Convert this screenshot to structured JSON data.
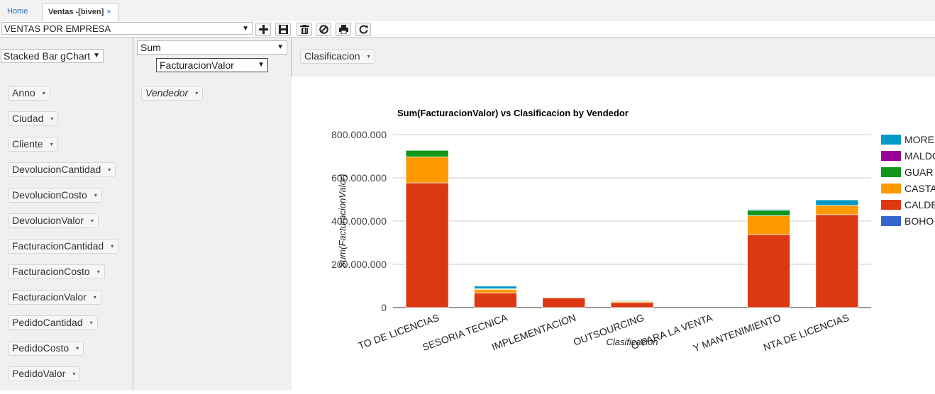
{
  "tabs": [
    {
      "label": "Home"
    },
    {
      "label": "Ventas -[biven]",
      "close": "×"
    }
  ],
  "toolbar": {
    "report_name": "VENTAS POR EMPRESA",
    "buttons": [
      "plus-icon",
      "save-icon",
      "trash-icon",
      "ban-icon",
      "print-icon",
      "refresh-icon"
    ]
  },
  "pivot": {
    "renderer": "Stacked Bar gChart",
    "aggregator": "Sum",
    "value_field": "FacturacionValor",
    "col_fields": [
      "Clasificacion"
    ],
    "row_fields": [
      "Vendedor"
    ],
    "unused_fields": [
      "Anno",
      "Ciudad",
      "Cliente",
      "DevolucionCantidad",
      "DevolucionCosto",
      "DevolucionValor",
      "FacturacionCantidad",
      "FacturacionCosto",
      "FacturacionValor",
      "PedidoCantidad",
      "PedidoCosto",
      "PedidoValor"
    ],
    "dropdown_glyph": "▾"
  },
  "chart_data": {
    "type": "bar",
    "stacked": true,
    "title": "Sum(FacturacionValor) vs Clasificacion by Vendedor",
    "xlabel": "Clasificacion",
    "ylabel": "Sum(FacturacionValor)",
    "ylim": [
      0,
      800000000
    ],
    "yticks": [
      "0",
      "200.000.000",
      "400.000.000",
      "600.000.000",
      "800.000.000"
    ],
    "ytick_values": [
      0,
      200000000,
      400000000,
      600000000,
      800000000
    ],
    "categories": [
      "TO DE LICENCIAS",
      "SESORIA TECNICA",
      "IMPLEMENTACION",
      "OUTSOURCING",
      "O PARA LA VENTA",
      "Y MANTENIMIENTO",
      "NTA DE LICENCIAS"
    ],
    "legend_position": "right",
    "series": [
      {
        "name": "BOHO",
        "color": "#3366cc",
        "values": [
          0,
          0,
          0,
          0,
          0,
          0,
          0
        ]
      },
      {
        "name": "CALDE",
        "color": "#dc3912",
        "values": [
          577000000,
          67000000,
          45000000,
          23000000,
          0,
          338000000,
          430000000
        ]
      },
      {
        "name": "CASTA",
        "color": "#ff9900",
        "values": [
          120000000,
          17000000,
          2000000,
          5000000,
          0,
          87000000,
          43000000
        ]
      },
      {
        "name": "GUAR",
        "color": "#109618",
        "values": [
          30000000,
          3000000,
          0,
          4000000,
          0,
          24000000,
          0
        ]
      },
      {
        "name": "MALDO",
        "color": "#990099",
        "values": [
          0,
          0,
          0,
          0,
          0,
          0,
          0
        ]
      },
      {
        "name": "MORE",
        "color": "#0099c6",
        "values": [
          0,
          12000000,
          1000000,
          1000000,
          0,
          5000000,
          25000000
        ]
      }
    ]
  }
}
